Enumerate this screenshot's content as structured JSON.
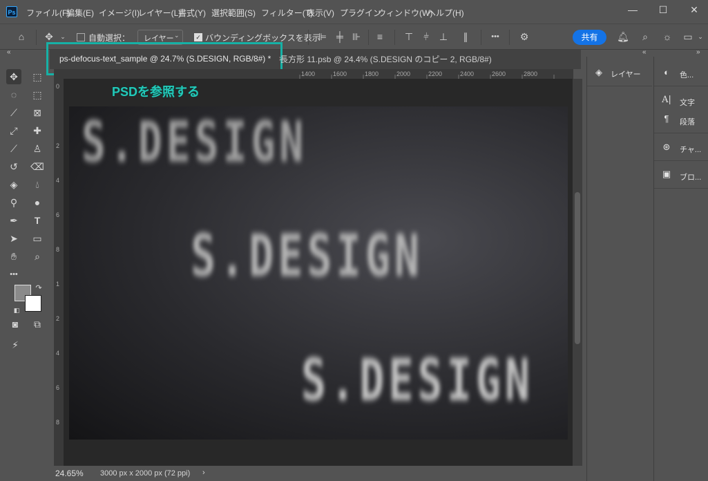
{
  "app": {
    "logo_text": "Ps"
  },
  "menu": [
    "ファイル(F)",
    "編集(E)",
    "イメージ(I)",
    "レイヤー(L)",
    "書式(Y)",
    "選択範囲(S)",
    "フィルター(T)",
    "表示(V)",
    "プラグイン",
    "ウィンドウ(W)",
    "ヘルプ(H)"
  ],
  "window_controls": {
    "minimize": "—",
    "maximize": "☐",
    "close": "✕"
  },
  "options": {
    "auto_select_label": "自動選択：",
    "layer_select": "レイヤー",
    "bounding_box_label": "バウンディングボックスを表示",
    "more": "•••",
    "share": "共有"
  },
  "tabs": {
    "active": "ps-defocus-text_sample @ 24.7% (S.DESIGN, RGB/8#) *",
    "active_close": "×",
    "inactive": "長方形 11.psb @ 24.4% (S.DESIGN のコピー 2, RGB/8#)"
  },
  "callout": "PSDを参照する",
  "ruler": {
    "top": [
      "1400",
      "1600",
      "1800",
      "2000",
      "2200",
      "2400",
      "2600",
      "2800"
    ],
    "left": [
      "0",
      "2",
      "4",
      "6",
      "8",
      "1",
      "2",
      "4",
      "6",
      "8"
    ]
  },
  "artwork": {
    "text": "S.DESIGN"
  },
  "status": {
    "zoom": "24.65%",
    "doc_info": "3000 px x 2000 px (72 ppi)",
    "arrow": "›"
  },
  "panels": {
    "col1": [
      {
        "label": "レイヤー",
        "icon": "layers-icon"
      }
    ],
    "col2": [
      {
        "label": "色...",
        "icon": "color-icon"
      },
      {
        "label": "文字",
        "icon": "character-icon"
      },
      {
        "label": "段落",
        "icon": "paragraph-icon"
      },
      {
        "label": "チャ...",
        "icon": "channels-icon"
      },
      {
        "label": "ブロ...",
        "icon": "brush-icon"
      }
    ]
  }
}
